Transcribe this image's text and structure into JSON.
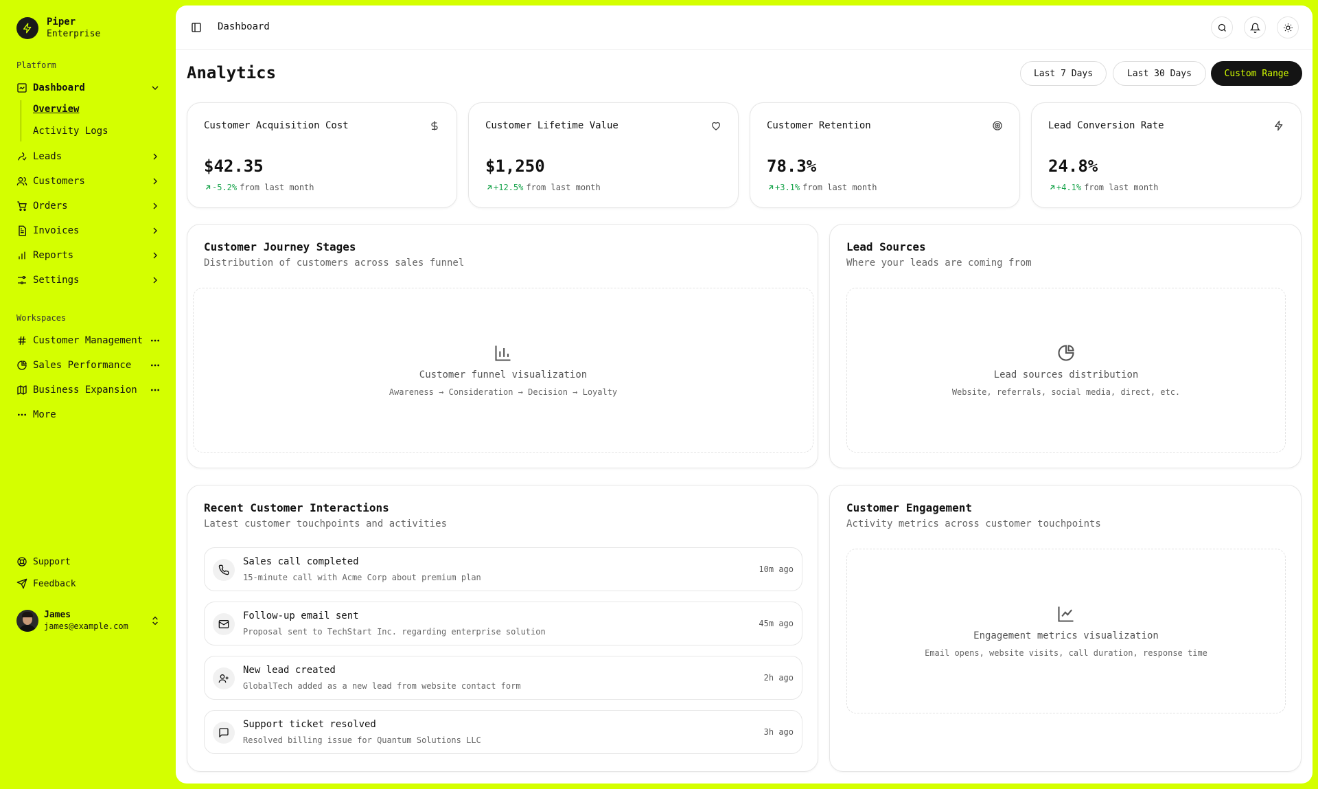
{
  "brand": {
    "name": "Piper",
    "subtitle": "Enterprise"
  },
  "sidebar": {
    "platform_label": "Platform",
    "nav": [
      {
        "label": "Dashboard",
        "icon": "dashboard-icon",
        "trail": "chevron-down-icon",
        "active": true
      },
      {
        "label": "Leads",
        "icon": "leads-icon",
        "trail": "chevron-right-icon"
      },
      {
        "label": "Customers",
        "icon": "users-icon",
        "trail": "chevron-right-icon"
      },
      {
        "label": "Orders",
        "icon": "cart-icon",
        "trail": "chevron-right-icon"
      },
      {
        "label": "Invoices",
        "icon": "invoice-icon",
        "trail": "chevron-right-icon"
      },
      {
        "label": "Reports",
        "icon": "bar-chart-icon",
        "trail": "chevron-right-icon"
      },
      {
        "label": "Settings",
        "icon": "settings-icon",
        "trail": "chevron-right-icon"
      }
    ],
    "dashboard_sub": [
      {
        "label": "Overview",
        "current": true
      },
      {
        "label": "Activity Logs"
      }
    ],
    "workspaces_label": "Workspaces",
    "workspaces": [
      {
        "label": "Customer Management",
        "icon": "hash-icon"
      },
      {
        "label": "Sales Performance",
        "icon": "pie-chart-icon"
      },
      {
        "label": "Business Expansion",
        "icon": "map-icon"
      }
    ],
    "more_label": "More",
    "footer": [
      {
        "label": "Support",
        "icon": "lifebuoy-icon"
      },
      {
        "label": "Feedback",
        "icon": "send-icon"
      }
    ],
    "user": {
      "name": "James",
      "email": "james@example.com"
    }
  },
  "topbar": {
    "breadcrumb": "Dashboard"
  },
  "page": {
    "title": "Analytics",
    "ranges": [
      {
        "label": "Last 7 Days",
        "active": false
      },
      {
        "label": "Last 30 Days",
        "active": false
      },
      {
        "label": "Custom Range",
        "active": true
      }
    ]
  },
  "kpis": [
    {
      "title": "Customer Acquisition Cost",
      "icon": "dollar-icon",
      "value": "$42.35",
      "delta": "-5.2%",
      "suffix": "from last month"
    },
    {
      "title": "Customer Lifetime Value",
      "icon": "heart-icon",
      "value": "$1,250",
      "delta": "+12.5%",
      "suffix": "from last month"
    },
    {
      "title": "Customer Retention",
      "icon": "target-icon",
      "value": "78.3%",
      "delta": "+3.1%",
      "suffix": "from last month"
    },
    {
      "title": "Lead Conversion Rate",
      "icon": "bolt-icon",
      "value": "24.8%",
      "delta": "+4.1%",
      "suffix": "from last month"
    }
  ],
  "journey": {
    "title": "Customer Journey Stages",
    "subtitle": "Distribution of customers across sales funnel",
    "placeholder_title": "Customer funnel visualization",
    "placeholder_sub": "Awareness → Consideration → Decision → Loyalty"
  },
  "lead_sources": {
    "title": "Lead Sources",
    "subtitle": "Where your leads are coming from",
    "placeholder_title": "Lead sources distribution",
    "placeholder_sub": "Website, referrals, social media, direct, etc."
  },
  "interactions": {
    "title": "Recent Customer Interactions",
    "subtitle": "Latest customer touchpoints and activities",
    "items": [
      {
        "icon": "phone-icon",
        "title": "Sales call completed",
        "desc": "15-minute call with Acme Corp about premium plan",
        "time": "10m ago"
      },
      {
        "icon": "mail-icon",
        "title": "Follow-up email sent",
        "desc": "Proposal sent to TechStart Inc. regarding enterprise solution",
        "time": "45m ago"
      },
      {
        "icon": "user-plus-icon",
        "title": "New lead created",
        "desc": "GlobalTech added as a new lead from website contact form",
        "time": "2h ago"
      },
      {
        "icon": "message-icon",
        "title": "Support ticket resolved",
        "desc": "Resolved billing issue for Quantum Solutions LLC",
        "time": "3h ago"
      }
    ]
  },
  "engagement": {
    "title": "Customer Engagement",
    "subtitle": "Activity metrics across customer touchpoints",
    "placeholder_title": "Engagement metrics visualization",
    "placeholder_sub": "Email opens, website visits, call duration, response time"
  },
  "colors": {
    "accent": "#d4ff00",
    "dark": "#141414",
    "positive": "#16a34a"
  }
}
